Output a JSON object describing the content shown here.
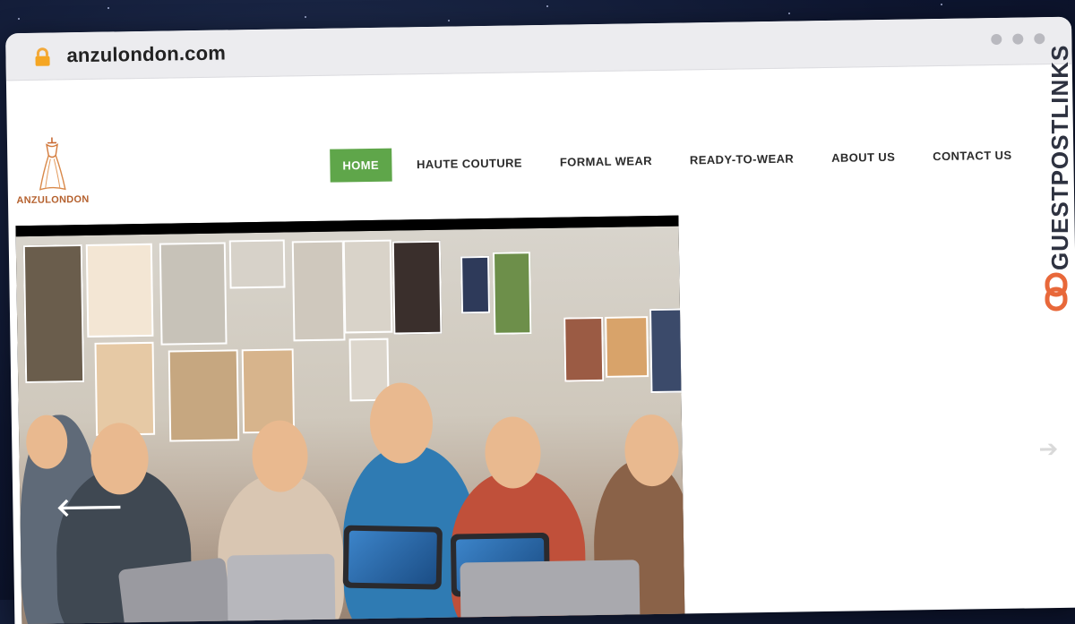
{
  "browser": {
    "url": "anzulondon.com",
    "lock_icon": "lock-icon",
    "window_controls": [
      "dot",
      "dot",
      "dot"
    ]
  },
  "site": {
    "logo_text": "ANZULONDON",
    "nav": [
      {
        "label": "HOME",
        "active": true
      },
      {
        "label": "HAUTE COUTURE",
        "active": false
      },
      {
        "label": "FORMAL WEAR",
        "active": false
      },
      {
        "label": "READY-TO-WEAR",
        "active": false
      },
      {
        "label": "ABOUT US",
        "active": false
      },
      {
        "label": "CONTACT US",
        "active": false
      }
    ],
    "slider": {
      "prev_icon": "arrow-left-icon",
      "next_icon": "arrow-right-icon",
      "prev_glyph": "🡐",
      "next_glyph": "➔"
    }
  },
  "watermark": {
    "text": "GUESTPOSTLINKS",
    "color": "#2e3240",
    "accent": "#e8683a"
  },
  "colors": {
    "nav_active": "#5fa64a",
    "logo": "#b5612e"
  }
}
